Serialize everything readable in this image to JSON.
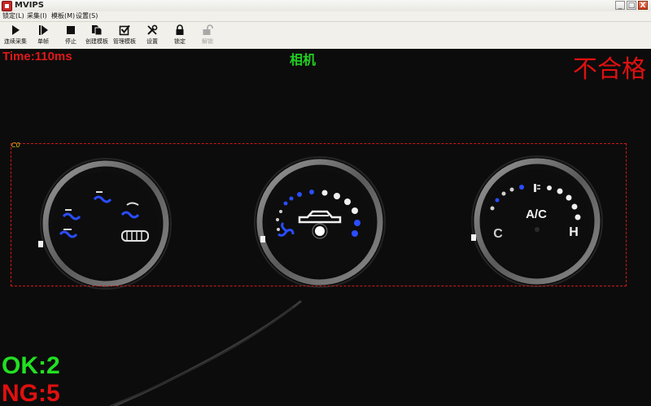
{
  "window": {
    "title": "MVIPS",
    "minimize": "_",
    "maximize": "□",
    "close": "X"
  },
  "menu": [
    "锁定(L)",
    "采集(I)",
    "模板(M)",
    "设置(S)"
  ],
  "toolbar": [
    {
      "label": "连续采集",
      "icon": "play-icon",
      "enabled": true
    },
    {
      "label": "单帧",
      "icon": "step-icon",
      "enabled": true
    },
    {
      "label": "停止",
      "icon": "stop-icon",
      "enabled": true
    },
    {
      "label": "创建模板",
      "icon": "create-template-icon",
      "enabled": true
    },
    {
      "label": "管理模板",
      "icon": "manage-template-icon",
      "enabled": true
    },
    {
      "label": "设置",
      "icon": "tools-icon",
      "enabled": true
    },
    {
      "label": "锁定",
      "icon": "lock-icon",
      "enabled": true
    },
    {
      "label": "解锁",
      "icon": "unlock-icon",
      "enabled": false
    }
  ],
  "view": {
    "time": "Time:110ms",
    "camera": "相机",
    "verdict": "不合格",
    "roi_label": "C0",
    "ok": "OK:2",
    "ng": "NG:5",
    "colors": {
      "ok": "#22e022",
      "ng": "#e01010",
      "camera": "#21d021",
      "roi": "#d01818"
    }
  },
  "knobs": {
    "right": {
      "ac_label": "A/C",
      "cold": "C",
      "hot": "H"
    }
  }
}
